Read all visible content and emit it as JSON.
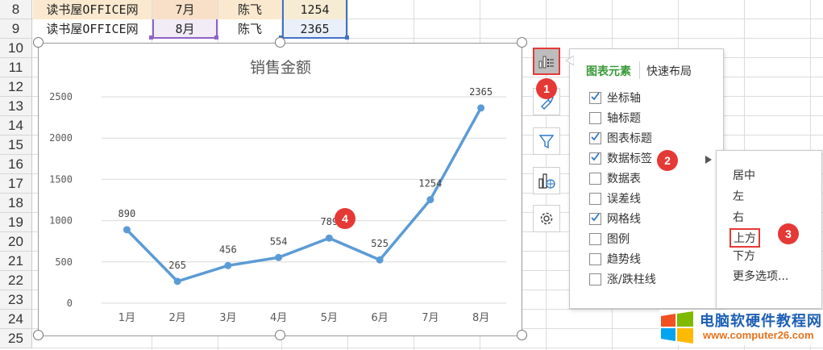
{
  "sheet": {
    "row_numbers": [
      "8",
      "9",
      "10",
      "11",
      "12",
      "13",
      "14",
      "15",
      "16",
      "17",
      "18",
      "19",
      "20",
      "21",
      "22",
      "23",
      "24",
      "25"
    ],
    "rows": [
      {
        "source": "读书屋OFFICE网",
        "month": "7月",
        "name": "陈飞",
        "amount": "1254"
      },
      {
        "source": "读书屋OFFICE网",
        "month": "8月",
        "name": "陈飞",
        "amount": "2365"
      }
    ]
  },
  "chart_data": {
    "type": "line",
    "title": "销售金额",
    "categories": [
      "1月",
      "2月",
      "3月",
      "4月",
      "5月",
      "6月",
      "7月",
      "8月"
    ],
    "series": [
      {
        "values": [
          890,
          265,
          456,
          554,
          789,
          525,
          1254,
          2365
        ]
      }
    ],
    "data_labels": [
      "890",
      "265",
      "456",
      "554",
      "789",
      "525",
      "1254",
      "2365"
    ],
    "y_ticks": [
      "0",
      "500",
      "1000",
      "1500",
      "2000",
      "2500"
    ],
    "ylim": [
      0,
      2500
    ],
    "grid": true,
    "line_color": "#5b9bd5"
  },
  "side_buttons": {
    "chart_elements_icon": "chart-elements-icon",
    "style_icon": "brush-icon",
    "filter_icon": "filter-icon",
    "chart_type_icon": "chart-type-icon",
    "settings_icon": "gear-icon"
  },
  "panel": {
    "tab_active": "图表元素",
    "tab_inactive": "快速布局",
    "options": [
      {
        "label": "坐标轴",
        "checked": true
      },
      {
        "label": "轴标题",
        "checked": false
      },
      {
        "label": "图表标题",
        "checked": true
      },
      {
        "label": "数据标签",
        "checked": true
      },
      {
        "label": "数据表",
        "checked": false
      },
      {
        "label": "误差线",
        "checked": false
      },
      {
        "label": "网格线",
        "checked": true
      },
      {
        "label": "图例",
        "checked": false
      },
      {
        "label": "趋势线",
        "checked": false
      },
      {
        "label": "涨/跌柱线",
        "checked": false
      }
    ]
  },
  "submenu": {
    "items": [
      "居中",
      "左",
      "右",
      "上方",
      "下方",
      "更多选项..."
    ],
    "selected": "上方"
  },
  "badges": [
    "1",
    "2",
    "3",
    "4"
  ],
  "watermark": {
    "title": "电脑软硬件教程网",
    "url": "www.computer26.com"
  },
  "colors": {
    "accent_green": "#3a9b3a",
    "badge_red": "#e53935",
    "line_blue": "#5b9bd5"
  }
}
